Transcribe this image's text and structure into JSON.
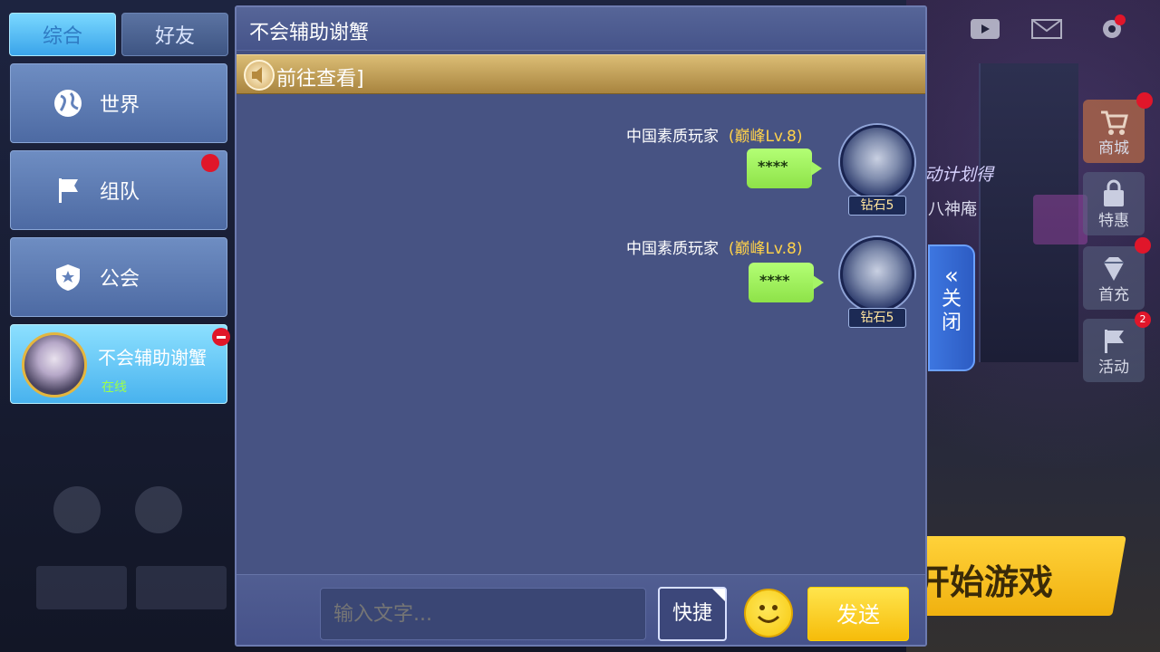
{
  "tabs": [
    {
      "label": "综合",
      "active": true
    },
    {
      "label": "好友",
      "active": false
    }
  ],
  "channels": [
    {
      "label": "世界",
      "icon": "globe-icon",
      "has_badge": false
    },
    {
      "label": "组队",
      "icon": "flag-icon",
      "has_badge": true
    },
    {
      "label": "公会",
      "icon": "guild-shield-icon",
      "has_badge": false
    }
  ],
  "friend": {
    "name": "不会辅助谢蟹",
    "status": "在线"
  },
  "chat": {
    "title": "不会辅助谢蟹",
    "notice": "前往查看]",
    "messages": [
      {
        "sender": "中国素质玩家",
        "level": "(巅峰Lv.8)",
        "text": "****",
        "rank": "钻石5"
      },
      {
        "sender": "中国素质玩家",
        "level": "(巅峰Lv.8)",
        "text": "****",
        "rank": "钻石5"
      }
    ],
    "input_placeholder": "输入文字...",
    "quick_label": "快捷",
    "send_label": "发送",
    "close_label": "关闭"
  },
  "background": {
    "event_text": "动计划得",
    "sub_text": "八神庵",
    "start_game": "开始游戏",
    "side_buttons": [
      {
        "label": "商城",
        "icon": "cart-icon"
      },
      {
        "label": "特惠",
        "icon": "gift-lock-icon"
      },
      {
        "label": "首充",
        "icon": "diamond-icon"
      },
      {
        "label": "活动",
        "icon": "flag-icon"
      }
    ],
    "activity_badge": "2"
  },
  "colors": {
    "accent_blue": "#48b2ee",
    "send_yellow": "#f6bc0a",
    "bubble_green": "#a5f466",
    "level_gold": "#ffd24a",
    "online_green": "#9dff4a"
  }
}
